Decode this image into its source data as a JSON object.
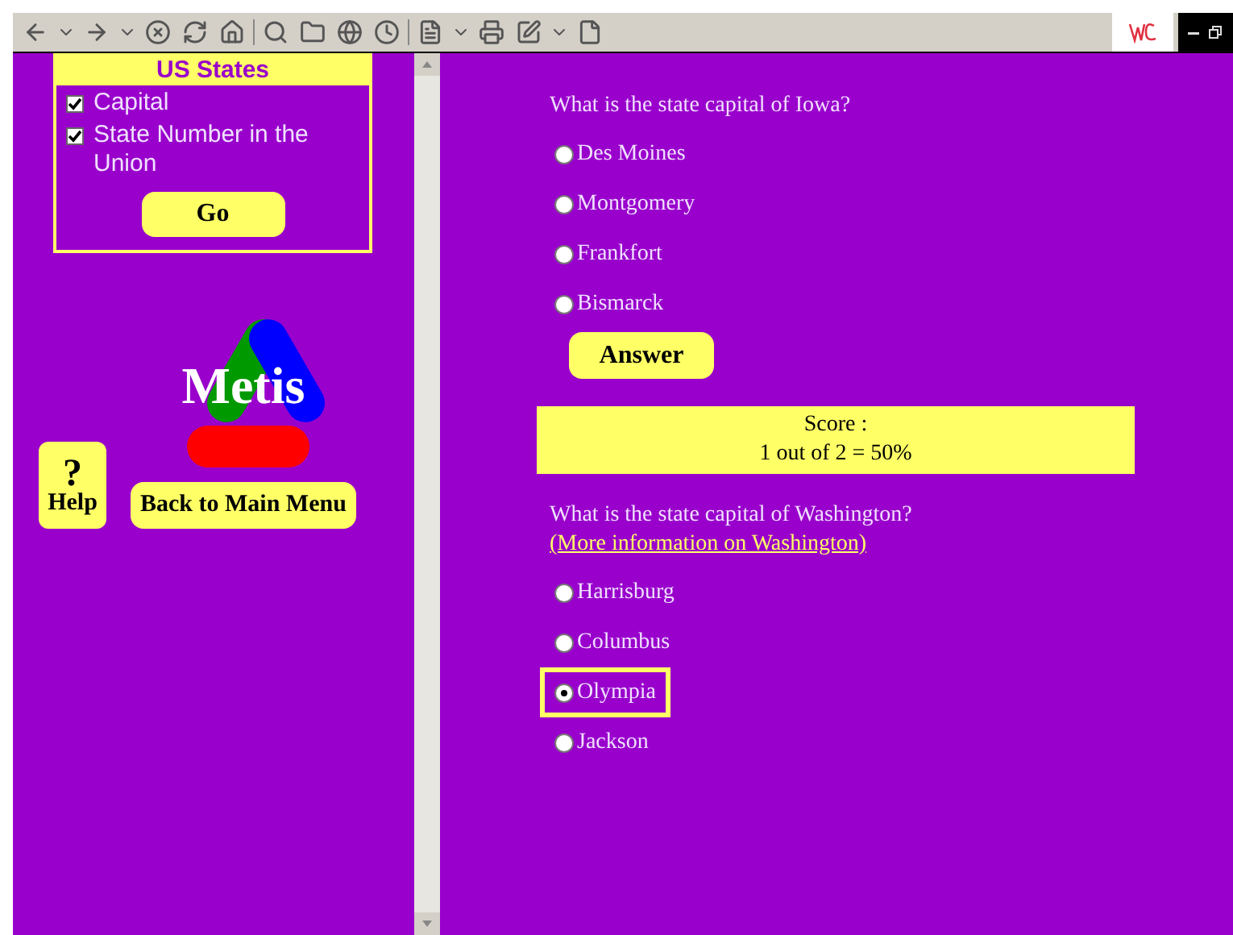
{
  "sidebar": {
    "title": "US States",
    "options": [
      {
        "label": "Capital",
        "checked": true
      },
      {
        "label": "State Number in the Union",
        "checked": true
      }
    ],
    "go_button": "Go",
    "logo": "Metis",
    "help": {
      "mark": "?",
      "label": "Help"
    },
    "back_button": "Back to Main Menu"
  },
  "quiz": {
    "questions": [
      {
        "question": "What is the state capital of Iowa?",
        "options": [
          {
            "label": "Des Moines",
            "selected": false,
            "highlighted": false
          },
          {
            "label": "Montgomery",
            "selected": false,
            "highlighted": false
          },
          {
            "label": "Frankfort",
            "selected": false,
            "highlighted": false
          },
          {
            "label": "Bismarck",
            "selected": false,
            "highlighted": false
          }
        ],
        "answer_button": "Answer",
        "score": {
          "label": "Score :",
          "value": "1 out of 2 = 50%"
        }
      },
      {
        "question": "What is the state capital of Washington?",
        "link": "(More information on Washington)",
        "options": [
          {
            "label": "Harrisburg",
            "selected": false,
            "highlighted": false
          },
          {
            "label": "Columbus",
            "selected": false,
            "highlighted": false
          },
          {
            "label": "Olympia",
            "selected": true,
            "highlighted": true
          },
          {
            "label": "Jackson",
            "selected": false,
            "highlighted": false
          }
        ]
      }
    ]
  }
}
